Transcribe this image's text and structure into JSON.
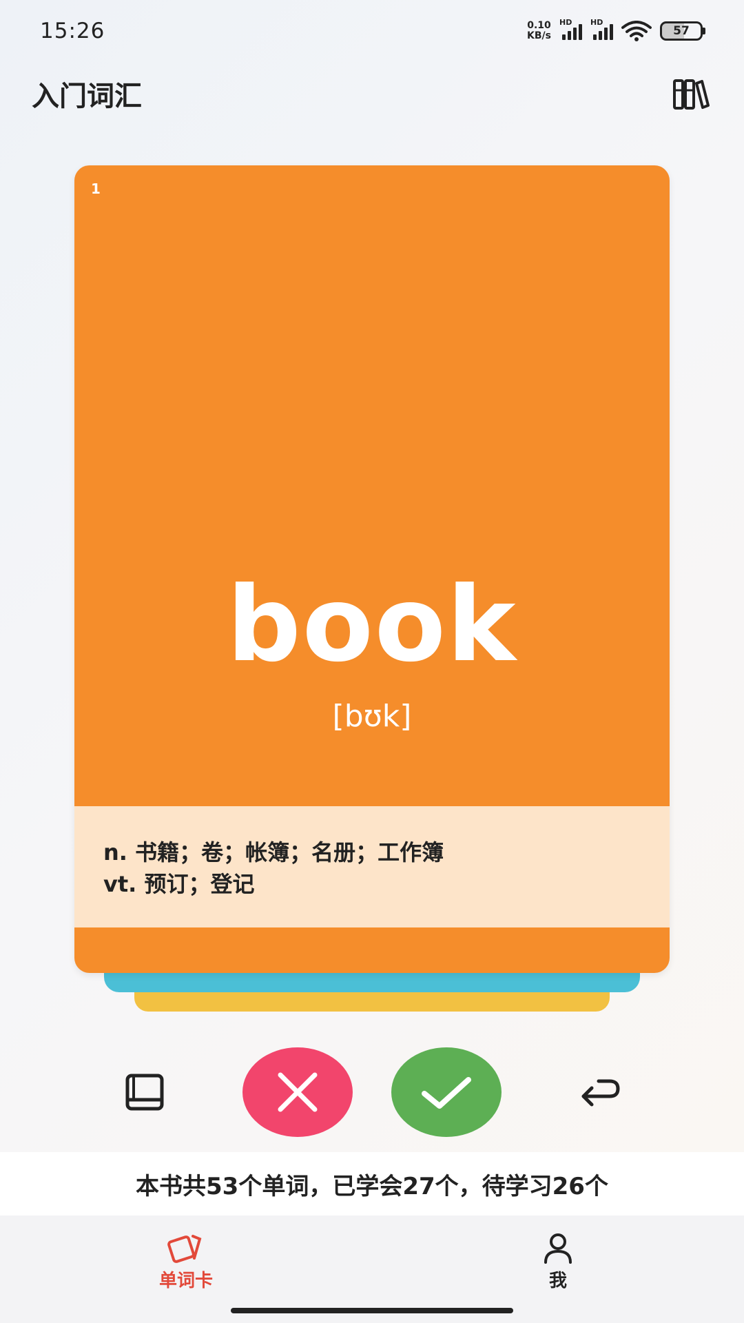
{
  "status_bar": {
    "time": "15:26",
    "net_speed_value": "0.10",
    "net_speed_unit": "KB/s",
    "hd1": "HD",
    "hd2": "HD",
    "battery": "57"
  },
  "header": {
    "title": "入门词汇",
    "library_icon": "bookshelf-icon"
  },
  "card": {
    "index": "1",
    "word": "book",
    "phonetic": "[bʊk]",
    "definitions": [
      "n. 书籍；卷；帐簿；名册；工作簿",
      "vt. 预订；登记"
    ],
    "colors": {
      "card": "#f58d2b",
      "definition_panel": "#fde4c9",
      "stack_blue": "#4bbfd6",
      "stack_yellow": "#f2c142"
    }
  },
  "actions": {
    "dictionary_icon": "book-icon",
    "forget_icon": "close-icon",
    "know_icon": "check-icon",
    "undo_icon": "undo-icon",
    "forget_color": "#f2456c",
    "know_color": "#5daf54"
  },
  "summary": {
    "text": "本书共53个单词，已学会27个，待学习26个"
  },
  "bottom_nav": {
    "items": [
      {
        "label": "单词卡",
        "icon": "cards-icon",
        "active": true
      },
      {
        "label": "我",
        "icon": "person-icon",
        "active": false
      }
    ],
    "active_color": "#e2493a"
  }
}
